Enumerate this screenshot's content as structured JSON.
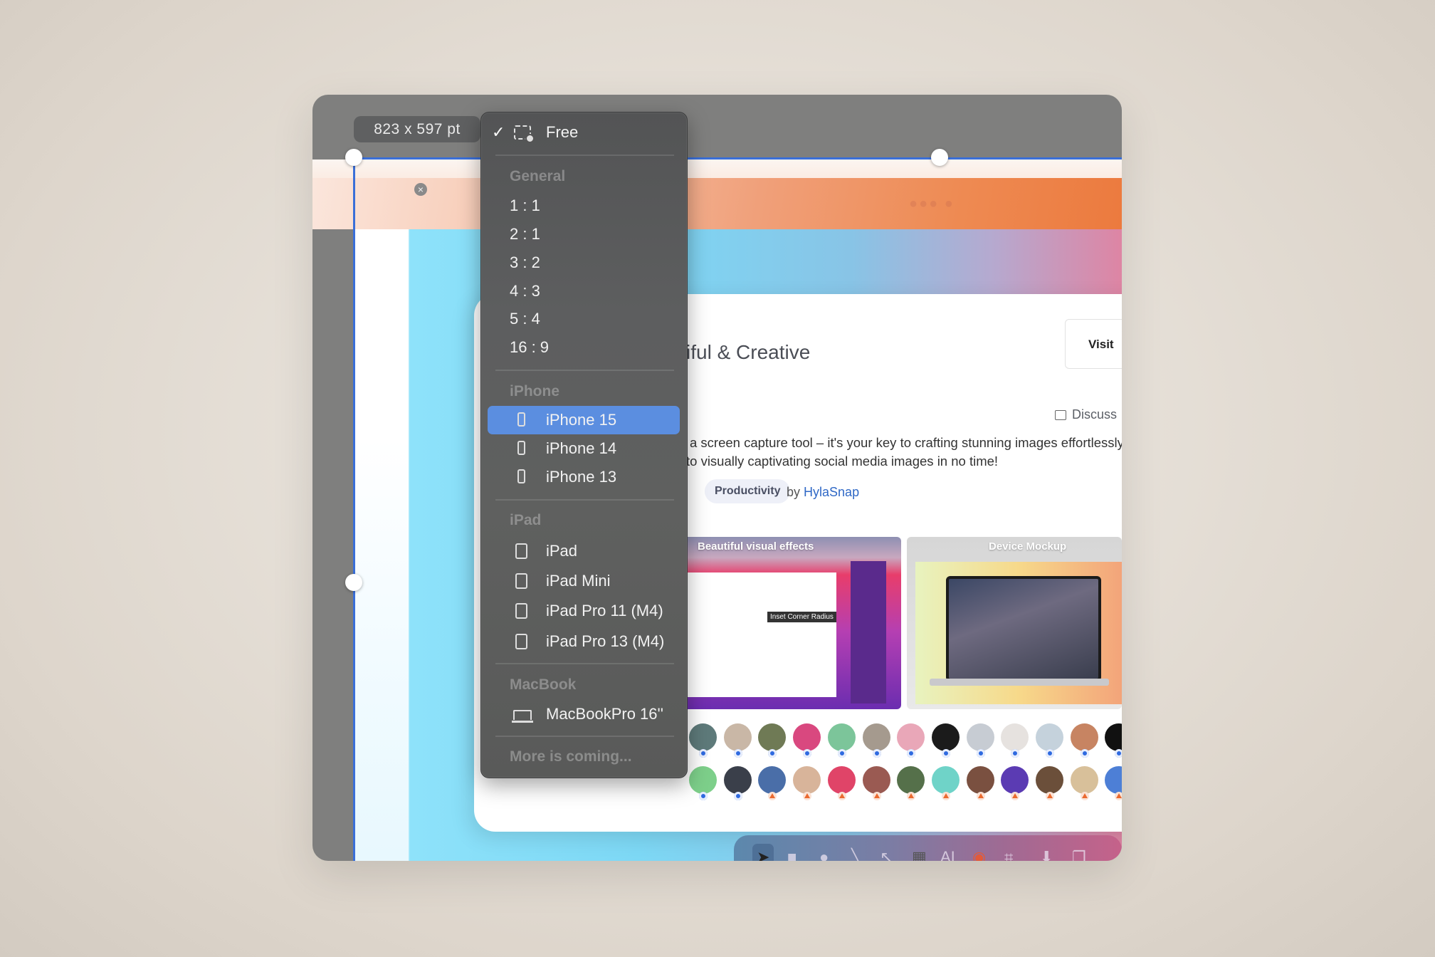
{
  "capture": {
    "dimensions_label": "823 x 597 pt",
    "close_icon": "close-icon",
    "accent_color": "#3a6fd8"
  },
  "aspect_menu": {
    "selected": "iPhone 15",
    "free": {
      "label": "Free",
      "checked": true,
      "icon": "free-crop-icon"
    },
    "sections": [
      {
        "header": "General",
        "items": [
          {
            "label": "1 : 1"
          },
          {
            "label": "2 : 1"
          },
          {
            "label": "3 : 2"
          },
          {
            "label": "4 : 3"
          },
          {
            "label": "5 : 4"
          },
          {
            "label": "16 : 9"
          }
        ]
      },
      {
        "header": "iPhone",
        "items": [
          {
            "label": "iPhone 15",
            "icon": "iphone-icon",
            "selected": true
          },
          {
            "label": "iPhone 14",
            "icon": "iphone-icon"
          },
          {
            "label": "iPhone 13",
            "icon": "iphone-icon"
          }
        ]
      },
      {
        "header": "iPad",
        "items": [
          {
            "label": "iPad",
            "icon": "ipad-icon"
          },
          {
            "label": "iPad Mini",
            "icon": "ipad-icon"
          },
          {
            "label": "iPad Pro 11 (M4)",
            "icon": "ipad-icon"
          },
          {
            "label": "iPad Pro 13 (M4)",
            "icon": "ipad-icon"
          }
        ]
      },
      {
        "header": "MacBook",
        "items": [
          {
            "label": "MacBookPro 16''",
            "icon": "macbook-icon"
          }
        ]
      }
    ],
    "footer": "More is coming...",
    "highlight_color": "#5b8ee0"
  },
  "webpage": {
    "headline_partial": "iful & Creative",
    "visit_label": "Visit",
    "discuss_label": "Discuss",
    "description_line1": "a screen capture tool – it's your key to crafting stunning images effortlessly.",
    "description_line2": "to visually captivating social media images in no time!",
    "tag": "Productivity",
    "by_prefix": "by",
    "maker": "HylaSnap",
    "gallery": [
      {
        "title": "Beautiful visual effects",
        "inner_caption": "Inset Corner Radius"
      },
      {
        "title": "Device Mockup"
      }
    ],
    "upvoters_row1_badges": [
      "comment",
      "comment",
      "comment",
      "comment",
      "comment",
      "comment",
      "comment",
      "comment",
      "comment",
      "comment",
      "comment",
      "comment",
      "comment"
    ],
    "upvoters_row2_badges": [
      "comment",
      "comment",
      "upvote",
      "upvote",
      "upvote",
      "upvote",
      "upvote",
      "upvote",
      "upvote",
      "upvote",
      "upvote",
      "upvote",
      "upvote"
    ]
  },
  "toolbar": {
    "tools": [
      "pointer-icon",
      "rectangle-icon",
      "circle-icon",
      "line-icon",
      "arrow-icon",
      "pixelate-icon",
      "ai-text-icon",
      "color-picker-icon",
      "crop-icon",
      "save-icon",
      "copy-icon"
    ]
  }
}
